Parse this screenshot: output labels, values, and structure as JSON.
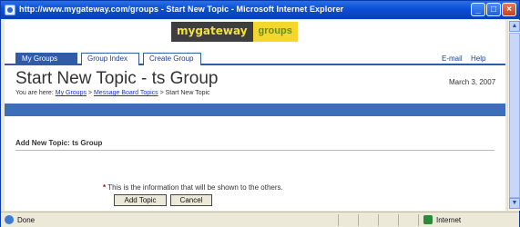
{
  "window": {
    "title": "http://www.mygateway.com/groups - Start New Topic - Microsoft Internet Explorer"
  },
  "logo": {
    "main": "mygateway",
    "sub": "groups"
  },
  "tabs": [
    {
      "label": "My Groups"
    },
    {
      "label": "Group Index"
    },
    {
      "label": "Create Group"
    }
  ],
  "toplinks": {
    "mail": "E-mail",
    "help": "Help"
  },
  "page": {
    "title": "Start New Topic - ts Group",
    "date": "March 3, 2007",
    "breadcrumb_prefix": "You are here:",
    "crumb1": "My Groups",
    "crumb2": "Message Board Topics",
    "crumb_current": "> Start New Topic"
  },
  "section": {
    "title": "Add New Topic: ts Group"
  },
  "form": {
    "required_star": "*",
    "required_text": "This is the information that will be shown to the others."
  },
  "buttons": {
    "add": "Add Topic",
    "cancel": "Cancel"
  },
  "status": {
    "text": "Done",
    "zone": "Internet"
  }
}
